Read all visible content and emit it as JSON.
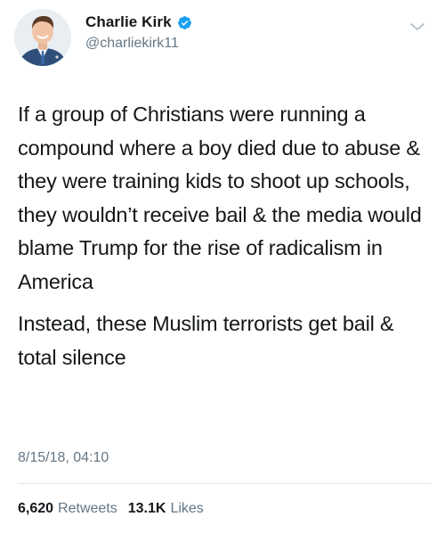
{
  "author": {
    "display_name": "Charlie Kirk",
    "handle": "@charliekirk11",
    "verified": true,
    "avatar_icon": "profile-photo"
  },
  "tweet": {
    "paragraphs": [
      "If a group of Christians were running a compound where a boy died due to abuse & they were training kids to shoot up schools, they wouldn’t receive bail & the media would blame Trump for the rise of radicalism in America",
      "Instead, these Muslim terrorists get bail & total silence"
    ],
    "timestamp": "8/15/18, 04:10"
  },
  "stats": {
    "retweets_count": "6,620",
    "retweets_label": "Retweets",
    "likes_count": "13.1K",
    "likes_label": "Likes"
  },
  "icons": {
    "verified": "verified-badge-icon",
    "menu": "chevron-down-icon"
  },
  "colors": {
    "verified_blue": "#1da1f2",
    "text_primary": "#14171a",
    "text_secondary": "#657786",
    "divider": "#e1e8ed"
  }
}
